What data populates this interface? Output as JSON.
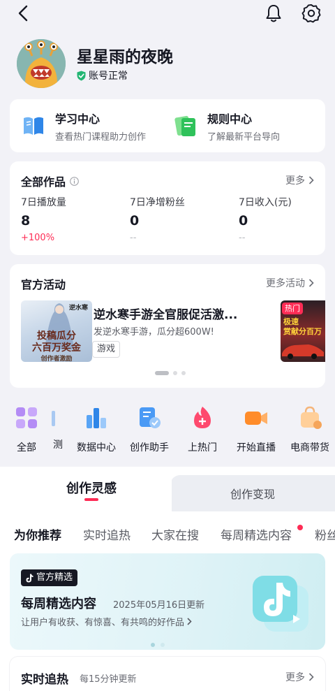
{
  "header": {
    "back_icon": "chevron-left-icon",
    "notification_icon": "bell-icon",
    "settings_icon": "gear-icon"
  },
  "profile": {
    "nickname": "星星雨的夜晚",
    "account_status": "账号正常",
    "status_color": "#22b573"
  },
  "centers": [
    {
      "title": "学习中心",
      "subtitle": "查看热门课程助力创作",
      "icon": "book-icon"
    },
    {
      "title": "规则中心",
      "subtitle": "了解最新平台导向",
      "icon": "rules-doc-icon"
    }
  ],
  "works": {
    "title": "全部作品",
    "more": "更多",
    "stats": [
      {
        "label": "7日播放量",
        "value": "8",
        "change": "+100%"
      },
      {
        "label": "7日净增粉丝",
        "value": "0",
        "change": "--"
      },
      {
        "label": "7日收入(元)",
        "value": "0",
        "change": "--"
      }
    ]
  },
  "activities": {
    "title": "官方活动",
    "more": "更多活动",
    "current": {
      "title": "逆水寒手游全官服促活激...",
      "desc": "发逆水寒手游，瓜分超600W!",
      "tag": "游戏",
      "image_lines": [
        "逆水寒",
        "投稿瓜分",
        "六百万奖金",
        "创作者激励"
      ]
    },
    "next": {
      "badge": "热门",
      "image_text": "极速\n赏献分百万"
    },
    "pages": 3,
    "active_page": 0
  },
  "tools": [
    {
      "label": "全部",
      "icon": "grid-icon"
    },
    {
      "label": "测",
      "icon": "partial-icon"
    },
    {
      "label": "数据中心",
      "icon": "bar-chart-icon"
    },
    {
      "label": "创作助手",
      "icon": "assistant-doc-icon"
    },
    {
      "label": "上热门",
      "icon": "flame-plus-icon"
    },
    {
      "label": "开始直播",
      "icon": "video-camera-icon"
    },
    {
      "label": "电商带货",
      "icon": "shopping-bag-icon"
    }
  ],
  "main_tabs": [
    {
      "label": "创作灵感",
      "active": true
    },
    {
      "label": "创作变现",
      "active": false
    }
  ],
  "sub_tabs": [
    {
      "label": "为你推荐",
      "active": true
    },
    {
      "label": "实时追热",
      "active": false
    },
    {
      "label": "大家在搜",
      "active": false
    },
    {
      "label": "每周精选内容",
      "active": false,
      "dot": true
    },
    {
      "label": "粉丝",
      "active": false
    }
  ],
  "weekly": {
    "badge": "官方精选",
    "title": "每周精选内容",
    "date": "2025年05月16日更新",
    "desc": "让用户有收获、有惊喜、有共鸣的好作品"
  },
  "realtime": {
    "title": "实时追热",
    "subtitle": "每15分钟更新",
    "more": "更多"
  }
}
